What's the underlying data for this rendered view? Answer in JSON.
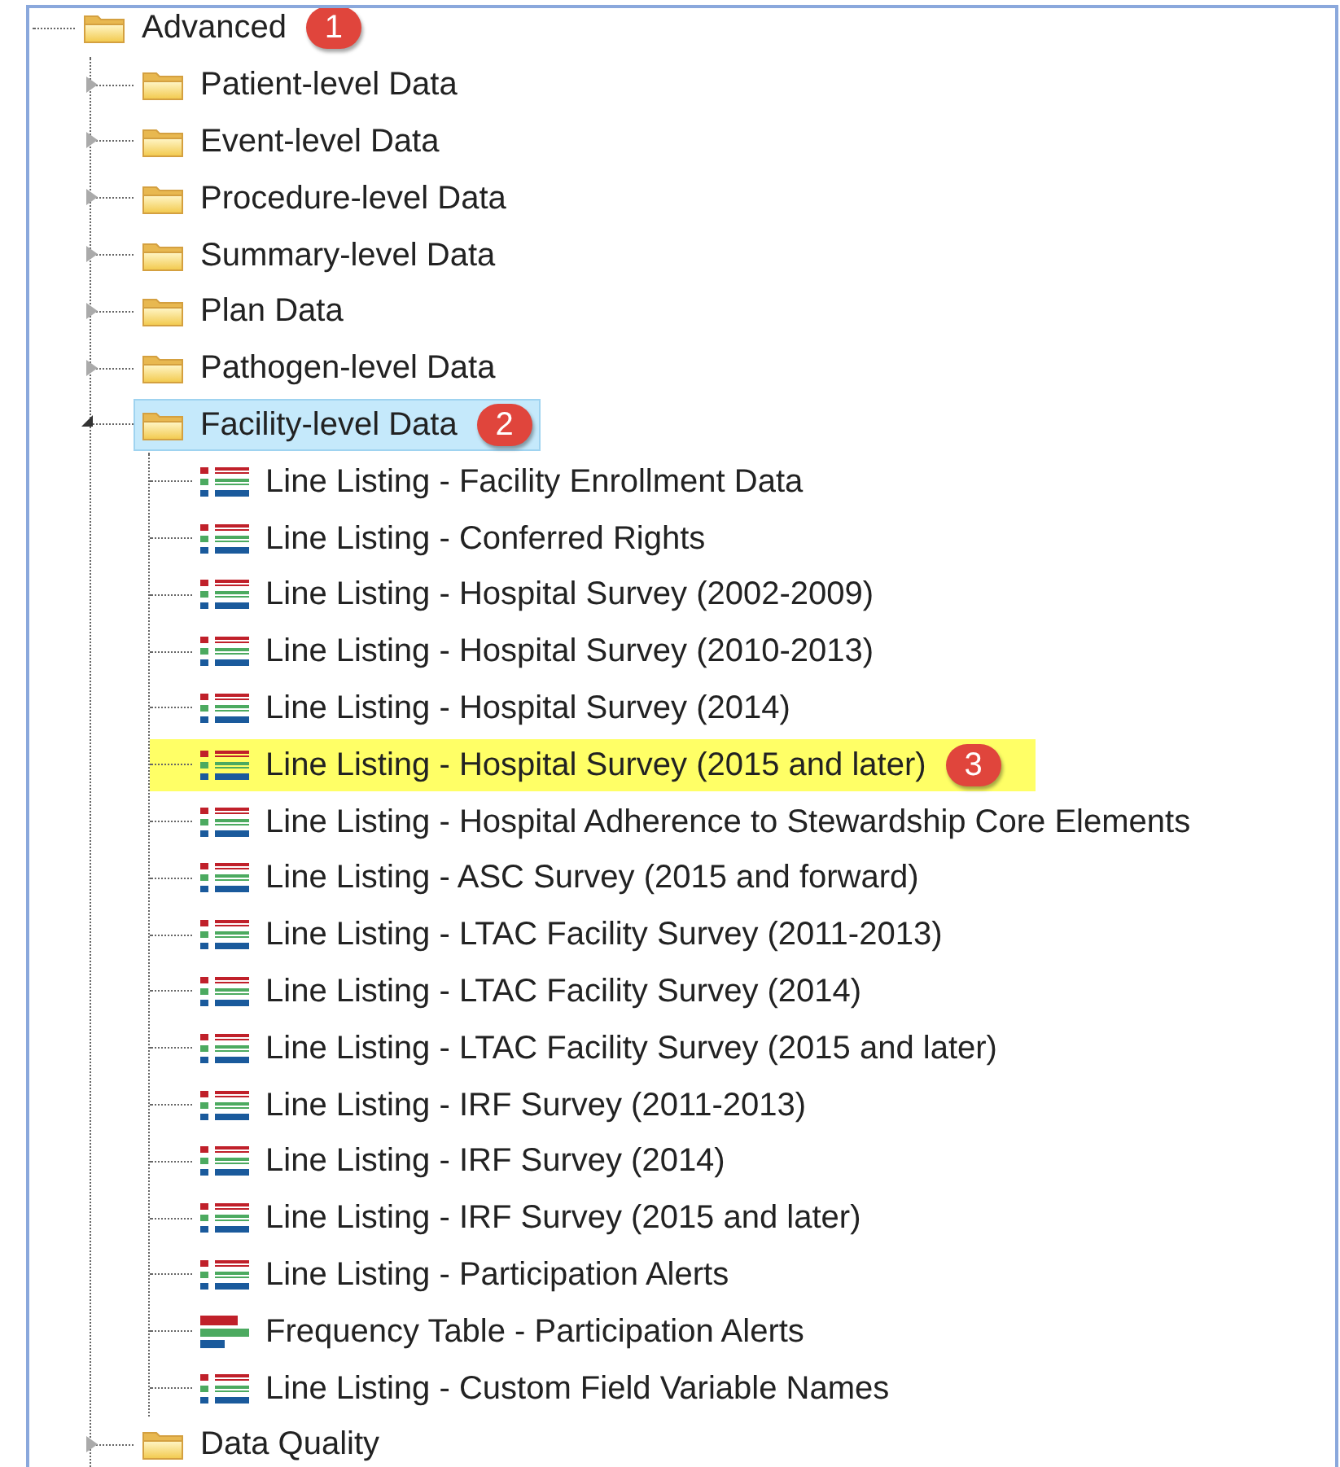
{
  "tree": {
    "label": "Advanced",
    "kind": "folder",
    "selected": false,
    "badge": "1",
    "children": [
      {
        "label": "Patient-level Data",
        "kind": "folder",
        "expanded": false,
        "selected": false
      },
      {
        "label": "Event-level Data",
        "kind": "folder",
        "expanded": false,
        "selected": false
      },
      {
        "label": "Procedure-level Data",
        "kind": "folder",
        "expanded": false,
        "selected": false
      },
      {
        "label": "Summary-level Data",
        "kind": "folder",
        "expanded": false,
        "selected": false
      },
      {
        "label": "Plan Data",
        "kind": "folder",
        "expanded": false,
        "selected": false
      },
      {
        "label": "Pathogen-level Data",
        "kind": "folder",
        "expanded": false,
        "selected": false
      },
      {
        "label": "Facility-level Data",
        "kind": "folder",
        "expanded": true,
        "selected": true,
        "badge": "2",
        "children": [
          {
            "label": "Line Listing - Facility Enrollment Data",
            "kind": "line_listing",
            "selected": false,
            "highlighted": false
          },
          {
            "label": "Line Listing - Conferred Rights",
            "kind": "line_listing",
            "selected": false,
            "highlighted": false
          },
          {
            "label": "Line Listing - Hospital Survey (2002-2009)",
            "kind": "line_listing",
            "selected": false,
            "highlighted": false
          },
          {
            "label": "Line Listing - Hospital Survey (2010-2013)",
            "kind": "line_listing",
            "selected": false,
            "highlighted": false
          },
          {
            "label": "Line Listing - Hospital Survey (2014)",
            "kind": "line_listing",
            "selected": false,
            "highlighted": false
          },
          {
            "label": "Line Listing - Hospital Survey (2015 and later)",
            "kind": "line_listing",
            "selected": false,
            "highlighted": true,
            "badge": "3"
          },
          {
            "label": "Line Listing - Hospital Adherence to Stewardship Core Elements",
            "kind": "line_listing",
            "selected": false,
            "highlighted": false
          },
          {
            "label": "Line Listing - ASC Survey (2015 and forward)",
            "kind": "line_listing",
            "selected": false,
            "highlighted": false
          },
          {
            "label": "Line Listing - LTAC Facility Survey (2011-2013)",
            "kind": "line_listing",
            "selected": false,
            "highlighted": false
          },
          {
            "label": "Line Listing - LTAC Facility Survey (2014)",
            "kind": "line_listing",
            "selected": false,
            "highlighted": false
          },
          {
            "label": "Line Listing - LTAC Facility Survey (2015 and later)",
            "kind": "line_listing",
            "selected": false,
            "highlighted": false
          },
          {
            "label": "Line Listing - IRF Survey (2011-2013)",
            "kind": "line_listing",
            "selected": false,
            "highlighted": false
          },
          {
            "label": "Line Listing - IRF Survey (2014)",
            "kind": "line_listing",
            "selected": false,
            "highlighted": false
          },
          {
            "label": "Line Listing - IRF Survey (2015 and later)",
            "kind": "line_listing",
            "selected": false,
            "highlighted": false
          },
          {
            "label": "Line Listing - Participation Alerts",
            "kind": "line_listing",
            "selected": false,
            "highlighted": false
          },
          {
            "label": "Frequency Table - Participation Alerts",
            "kind": "frequency_table",
            "selected": false,
            "highlighted": false
          },
          {
            "label": "Line Listing - Custom Field Variable Names",
            "kind": "line_listing",
            "selected": false,
            "highlighted": false
          }
        ]
      },
      {
        "label": "Data Quality",
        "kind": "folder",
        "expanded": false,
        "selected": false
      }
    ]
  }
}
